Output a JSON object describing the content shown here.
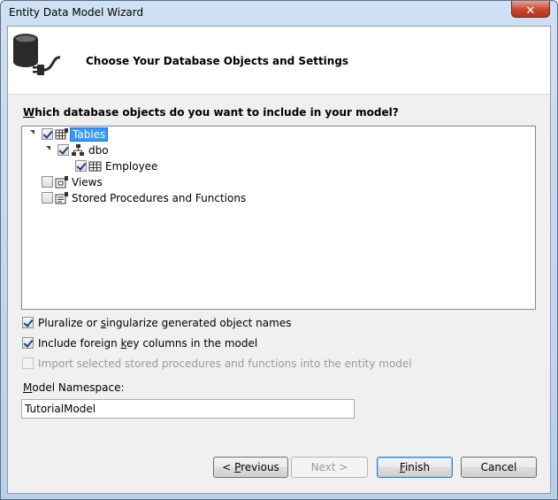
{
  "window": {
    "title": "Entity Data Model Wizard",
    "close_glyph": "✕"
  },
  "header": {
    "title": "Choose Your Database Objects and Settings",
    "icon": "database-plug-icon"
  },
  "question": {
    "prefix": "W",
    "rest": "hich database objects do you want to include in your model?"
  },
  "tree": {
    "tables": {
      "label": "Tables",
      "checked": true,
      "expanded": true,
      "selected": true
    },
    "dbo": {
      "label": "dbo",
      "checked": true,
      "expanded": true
    },
    "employee": {
      "label": "Employee",
      "checked": true
    },
    "views": {
      "label": "Views",
      "checked": false
    },
    "procedures": {
      "label": "Stored Procedures and Functions",
      "checked": false
    }
  },
  "options": {
    "pluralize": {
      "before": "Pluralize or ",
      "ul": "s",
      "after": "ingularize generated object names",
      "checked": true,
      "enabled": true
    },
    "foreign_key": {
      "before": "Include foreign ",
      "ul": "k",
      "after": "ey columns in the model",
      "checked": true,
      "enabled": true
    },
    "import_procs": {
      "label": "Import selected stored procedures and functions into the entity model",
      "checked": false,
      "enabled": false
    }
  },
  "namespace": {
    "ul": "M",
    "rest": "odel Namespace:",
    "value": "TutorialModel"
  },
  "buttons": {
    "previous": {
      "before": "< ",
      "ul": "P",
      "after": "revious"
    },
    "next": {
      "label": "Next >"
    },
    "finish": {
      "ul": "F",
      "after": "inish"
    },
    "cancel": {
      "label": "Cancel"
    }
  },
  "colors": {
    "selection": "#3399ff",
    "close": "#c7472c"
  }
}
